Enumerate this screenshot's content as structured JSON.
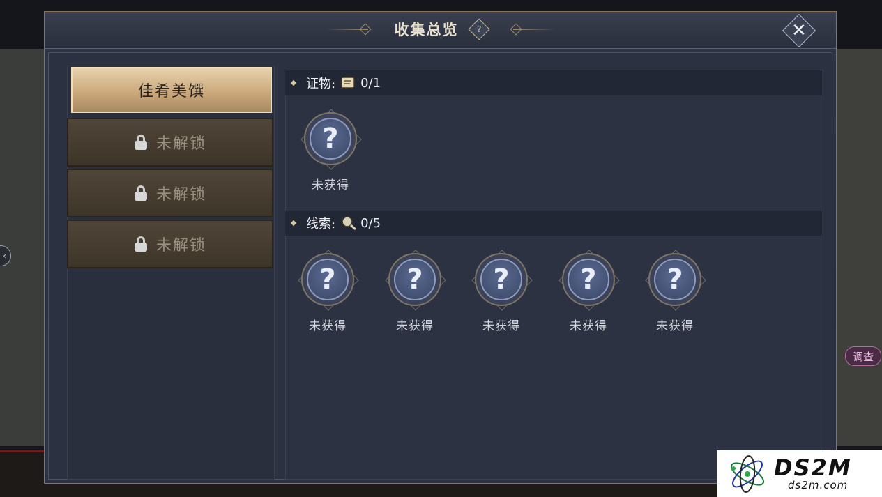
{
  "panel": {
    "title": "收集总览",
    "help_label": "?",
    "close_label": "✕"
  },
  "categories": [
    {
      "label": "佳肴美馔",
      "active": true,
      "locked": false
    },
    {
      "label": "未解锁",
      "active": false,
      "locked": true
    },
    {
      "label": "未解锁",
      "active": false,
      "locked": true
    },
    {
      "label": "未解锁",
      "active": false,
      "locked": true
    }
  ],
  "sections": {
    "evidence": {
      "label": "证物:",
      "icon": "scroll-icon",
      "count": "0/1",
      "items": [
        {
          "symbol": "?",
          "caption": "未获得"
        }
      ]
    },
    "clues": {
      "label": "线索:",
      "icon": "magnifier-icon",
      "count": "0/5",
      "items": [
        {
          "symbol": "?",
          "caption": "未获得"
        },
        {
          "symbol": "?",
          "caption": "未获得"
        },
        {
          "symbol": "?",
          "caption": "未获得"
        },
        {
          "symbol": "?",
          "caption": "未获得"
        },
        {
          "symbol": "?",
          "caption": "未获得"
        }
      ]
    }
  },
  "background": {
    "side_arrow": "‹",
    "investigate_label": "调查"
  },
  "watermark": {
    "brand": "DS2M",
    "site": "ds2m.com"
  },
  "colors": {
    "panel_bg": "#2c3141",
    "active_tab": "#c9a679",
    "locked_tab": "#4f4538",
    "section_header": "#222735"
  }
}
